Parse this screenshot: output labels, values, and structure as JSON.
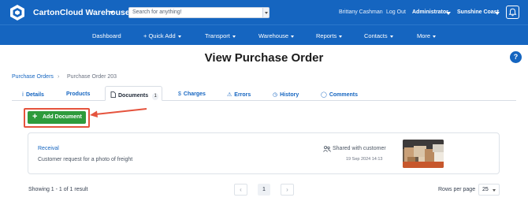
{
  "topbar": {
    "app_title": "CartonCloud Warehouse",
    "search_placeholder": "Search for anything!",
    "user_name": "Brittany Cashman",
    "logout_label": "Log Out",
    "role_label": "Administrator",
    "location_label": "Sunshine Coast",
    "icons": [
      "cartoncloud-logo-icon",
      "bell-icon"
    ]
  },
  "mainnav": {
    "items": [
      {
        "label": "Dashboard"
      },
      {
        "label": "+ Quick Add"
      },
      {
        "label": "Transport"
      },
      {
        "label": "Warehouse"
      },
      {
        "label": "Reports"
      },
      {
        "label": "Contacts"
      },
      {
        "label": "More"
      }
    ]
  },
  "page": {
    "title": "View Purchase Order",
    "help_label": "?",
    "breadcrumb": {
      "root": "Purchase Orders",
      "separator": "›",
      "current": "Purchase Order 203"
    }
  },
  "tabs": [
    {
      "label": "Details",
      "icon": "info-icon",
      "icon_glyph": "ⅰ"
    },
    {
      "label": "Products",
      "icon": "",
      "icon_glyph": ""
    },
    {
      "label": "Documents",
      "icon": "document-icon",
      "icon_glyph": "🗋",
      "badge": "1",
      "active": true
    },
    {
      "label": "Charges",
      "icon": "dollar-icon",
      "icon_glyph": "$"
    },
    {
      "label": "Errors",
      "icon": "warning-icon",
      "icon_glyph": "⚠"
    },
    {
      "label": "History",
      "icon": "clock-icon",
      "icon_glyph": "◷"
    },
    {
      "label": "Comments",
      "icon": "comment-icon",
      "icon_glyph": "◯"
    }
  ],
  "actions": {
    "add_document_label": "Add Document",
    "add_icon": "plus-icon",
    "add_glyph": "+"
  },
  "documents": [
    {
      "title": "Receival",
      "description": "Customer request for a photo of freight",
      "shared_label": "Shared with customer",
      "shared_icon": "users-icon",
      "date": "19 Sep 2024 14:13",
      "thumbnail": "freight-photo-thumbnail"
    }
  ],
  "pagination": {
    "showing": "Showing 1 - 1 of 1 result",
    "prev_glyph": "‹",
    "next_glyph": "›",
    "current_page": "1",
    "rows_label": "Rows per page",
    "rows_value": "25"
  },
  "colors": {
    "brand_blue": "#1565c0",
    "add_green": "#2e9b3c",
    "highlight_red": "#e5533d"
  }
}
